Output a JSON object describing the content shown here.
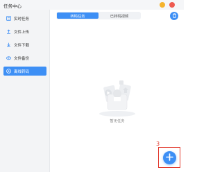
{
  "window": {
    "title": "任务中心"
  },
  "sidebar": {
    "items": [
      {
        "label": "实时任务",
        "icon": "list-icon",
        "active": false
      },
      {
        "label": "文件上传",
        "icon": "upload-icon",
        "active": false
      },
      {
        "label": "文件下载",
        "icon": "download-icon",
        "active": false
      },
      {
        "label": "文件备份",
        "icon": "cloud-backup-icon",
        "active": false
      },
      {
        "label": "离线转码",
        "icon": "transcode-icon",
        "active": true
      }
    ]
  },
  "main": {
    "tabs": [
      {
        "label": "转码任务",
        "active": true
      },
      {
        "label": "已转码视频",
        "active": false
      }
    ],
    "empty_text": "暂无任务",
    "step_marker": "3",
    "add_icon": "plus-icon",
    "trash_icon": "trash-icon"
  },
  "colors": {
    "accent": "#3d8ff5",
    "highlight": "#e23a2e"
  }
}
